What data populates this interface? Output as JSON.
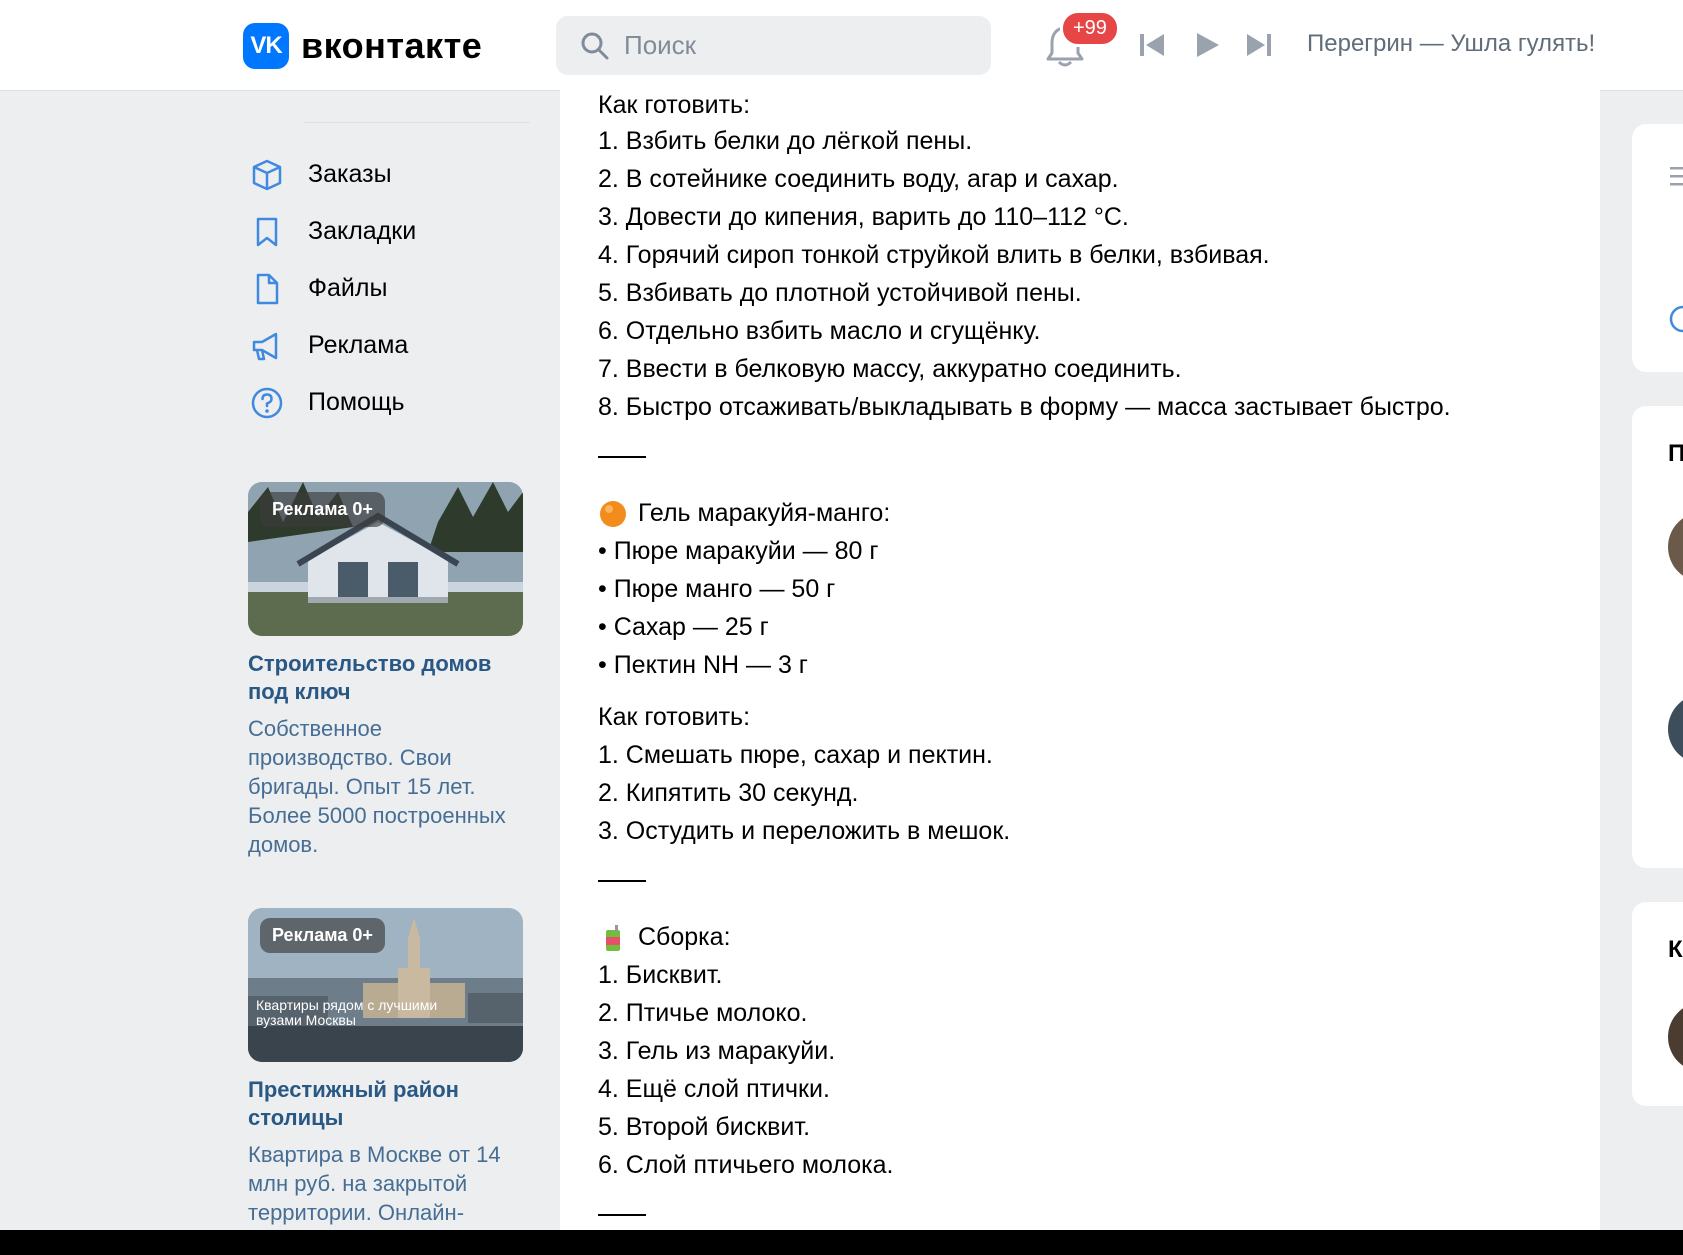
{
  "header": {
    "logo_text": "вконтакте",
    "logo_mark": "VK",
    "search_placeholder": "Поиск",
    "notifications_badge": "+99",
    "now_playing": "Перегрин — Ушла гулять!"
  },
  "nav": {
    "items": [
      {
        "label": "Заказы",
        "icon": "box-icon"
      },
      {
        "label": "Закладки",
        "icon": "bookmark-icon"
      },
      {
        "label": "Файлы",
        "icon": "file-icon"
      },
      {
        "label": "Реклама",
        "icon": "megaphone-icon"
      },
      {
        "label": "Помощь",
        "icon": "help-icon"
      }
    ]
  },
  "ads": [
    {
      "badge": "Реклама 0+",
      "title": "Строительство домов под ключ",
      "description": "Собственное производство. Свои бригады. Опыт 15 лет. Более 5000 построенных домов."
    },
    {
      "badge": "Реклама 0+",
      "title": "Престижный район столицы",
      "description": "Квартира в Москве от 14 млн руб. на закрытой территории. Онлайн-",
      "image_text": "Квартиры рядом с лучшими вузами Москвы"
    }
  ],
  "post": {
    "section1_heading": "Как готовить:",
    "section1_steps": [
      "1. Взбить белки до лёгкой пены.",
      "2. В сотейнике соединить воду, агар и сахар.",
      "3. Довести до кипения, варить до 110–112 °C.",
      "4. Горячий сироп тонкой струйкой влить в белки, взбивая.",
      "5. Взбивать до плотной устойчивой пены.",
      "6. Отдельно взбить масло и сгущёнку.",
      "7. Ввести в белковую массу, аккуратно соединить.",
      "8. Быстро отсаживать/выкладывать в форму — масса застывает быстро."
    ],
    "gel_heading": "Гель маракуйя-манго:",
    "gel_ingredients": [
      "• Пюре маракуйи — 80 г",
      "• Пюре манго — 50 г",
      "• Сахар — 25 г",
      "• Пектин NH — 3 г"
    ],
    "gel_method_heading": "Как готовить:",
    "gel_steps": [
      "1. Смешать пюре, сахар и пектин.",
      "2. Кипятить 30 секунд.",
      "3. Остудить и переложить в мешок."
    ],
    "assembly_heading": "Сборка:",
    "assembly_steps": [
      "1. Бисквит.",
      "2. Птичье молоко.",
      "3. Гель из маракуйи.",
      "4. Ещё слой птички.",
      "5. Второй бисквит.",
      "6. Слой птичьего молока."
    ]
  },
  "right_column": {
    "card2_letter": "П",
    "card3_letter": "К"
  },
  "colors": {
    "vk_blue": "#0077ff",
    "link_blue": "#2a5885",
    "badge_red": "#e64646",
    "page_bg": "#edeef0"
  }
}
